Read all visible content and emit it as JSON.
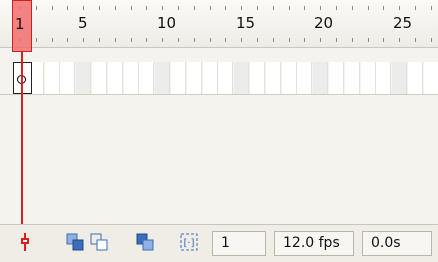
{
  "ruler": {
    "labels": [
      "1",
      "5",
      "10",
      "15",
      "20",
      "25"
    ]
  },
  "playhead": {
    "frame_label": "1"
  },
  "frames": {
    "keyframe_frame": 1,
    "visible_frame_count": 28
  },
  "toolbar": {
    "current_frame": "1",
    "frame_rate": "12.0 fps",
    "elapsed_time": "0.0s"
  },
  "icons": {
    "center_frame": "center-frame-icon",
    "onion_skin": "onion-skin-icon",
    "onion_skin_outlines": "onion-skin-outlines-icon",
    "edit_multiple_frames": "edit-multiple-frames-icon",
    "modify_onion_markers": "modify-onion-markers-icon"
  },
  "colors": {
    "playhead": "#e01e1e",
    "playhead_fill": "#f26e6e",
    "toolbar_icon": "#3b6db8"
  }
}
